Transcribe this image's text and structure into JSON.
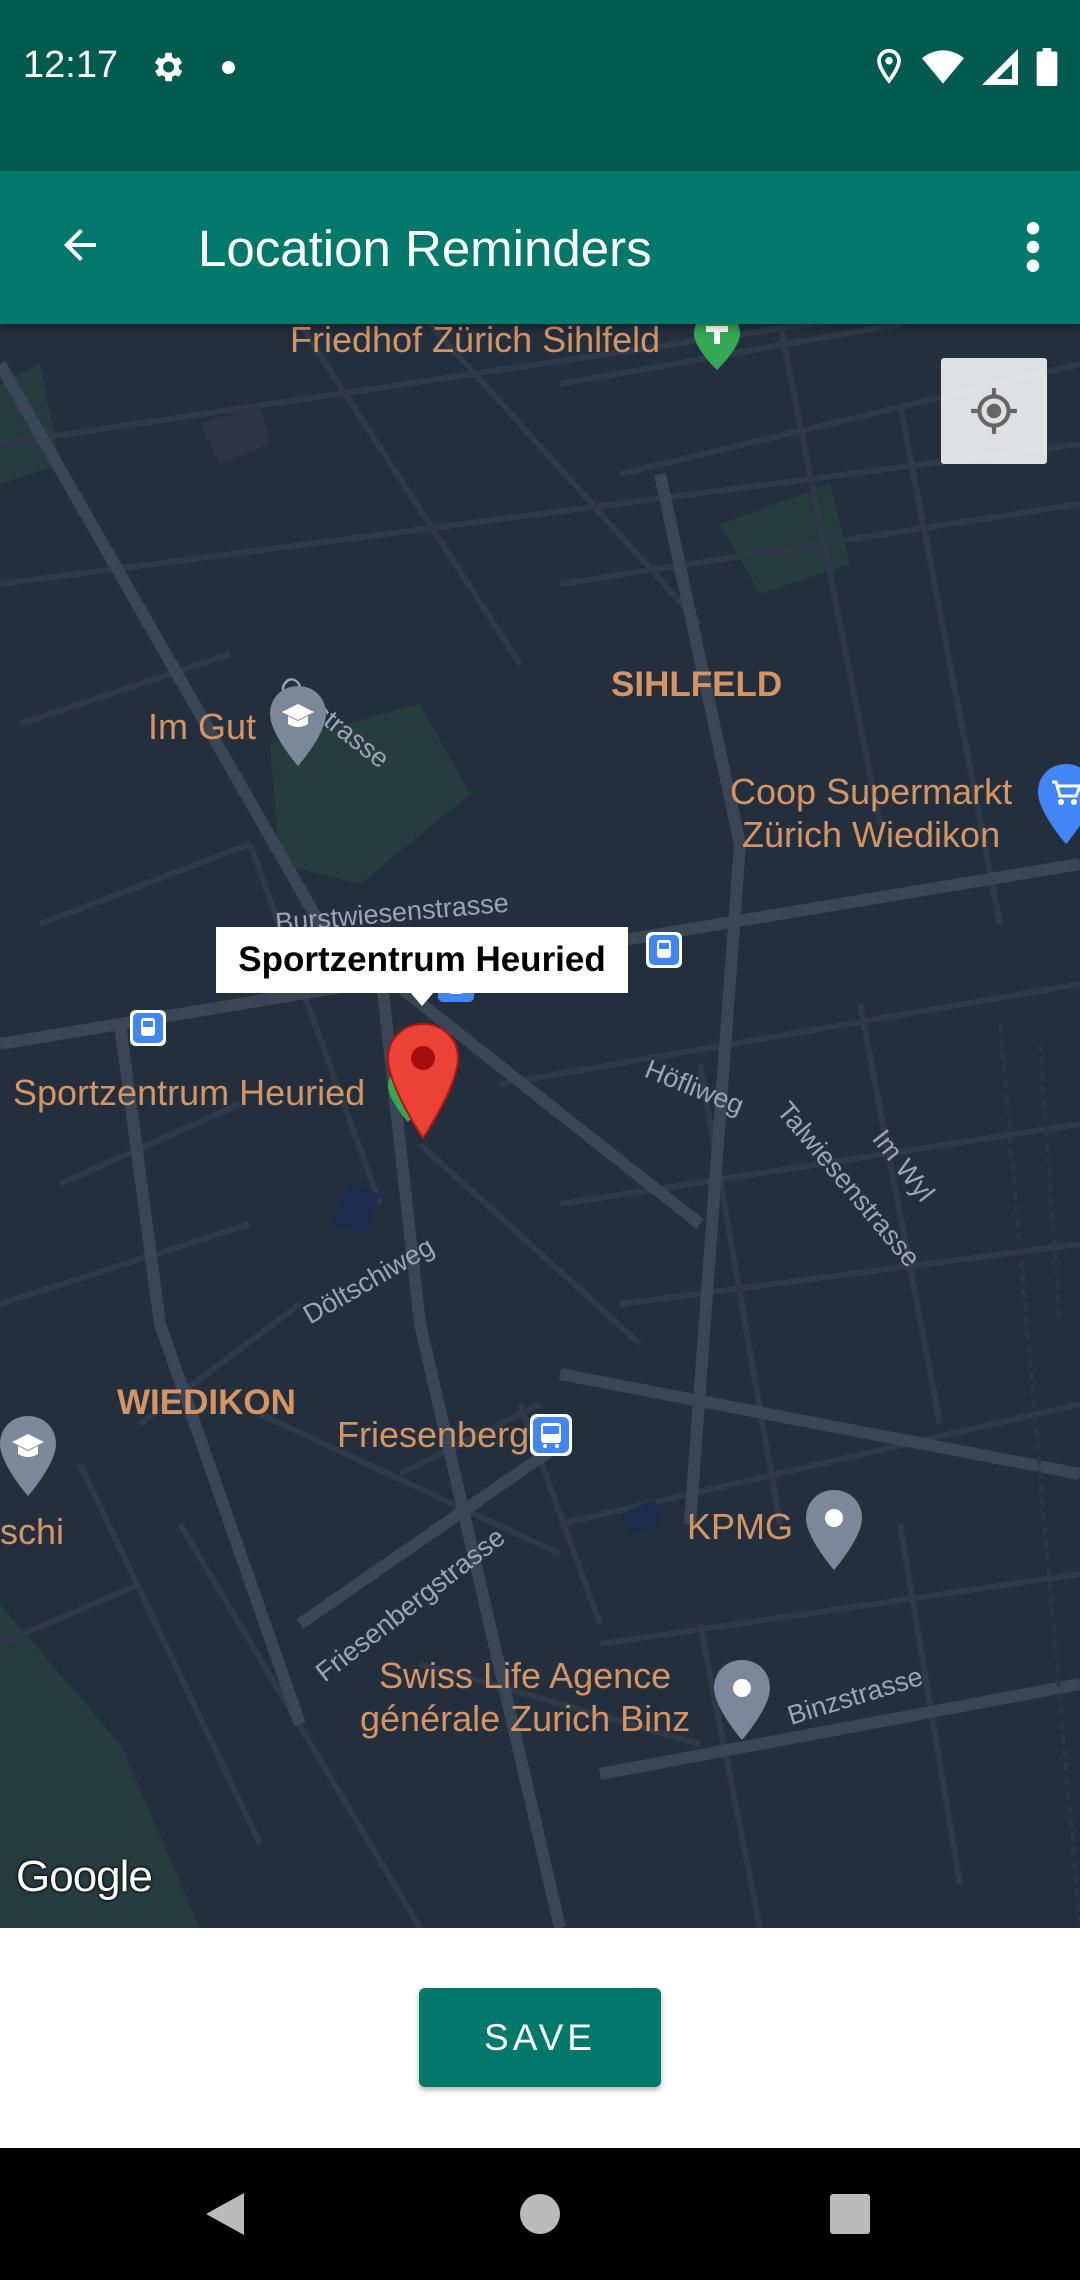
{
  "status_bar": {
    "time": "12:17",
    "icons": [
      "gear-icon",
      "notification-dot-icon",
      "location-icon",
      "wifi-icon",
      "signal-icon",
      "battery-icon"
    ]
  },
  "app_bar": {
    "title": "Location Reminders",
    "back_icon": "arrow-back-icon",
    "menu_icon": "more-vert-icon"
  },
  "map": {
    "selected_poi": "Sportzentrum Heuried",
    "attribution": "Google",
    "labels": {
      "friedhof": "Friedhof Zürich Sihlfeld",
      "sihlfeld": "SIHLFELD",
      "im_gut": "Im Gut",
      "coop_line1": "Coop Supermarkt",
      "coop_line2": "Zürich Wiedikon",
      "sportzentrum": "Sportzentrum Heuried",
      "wiedikon": "WIEDIKON",
      "friesenberg": "Friesenberg",
      "kpmg": "KPMG",
      "schi": "schi",
      "swiss_life_line1": "Swiss Life Agence",
      "swiss_life_line2": "générale Zurich Binz"
    },
    "streets": {
      "gutstrasse": "Gutstrasse",
      "burstwiesenstrasse": "Burstwiesenstrasse",
      "hoefliweg": "Höfliweg",
      "talwiesenstrasse": "Talwiesenstrasse",
      "im_wyl": "Im Wyl",
      "doeltschiweg": "Döltschiweg",
      "friesenbergstrasse": "Friesenbergstrasse",
      "binzstrasse": "Binzstrasse"
    },
    "colors": {
      "background": "#242f3e",
      "label": "#d59563",
      "marker": "#ea4335"
    }
  },
  "actions": {
    "save_label": "SAVE"
  },
  "nav_bar": {
    "icons": [
      "back-triangle-icon",
      "home-circle-icon",
      "recents-square-icon"
    ]
  },
  "theme": {
    "primary": "#00796b",
    "primary_dark": "#005b4f"
  }
}
